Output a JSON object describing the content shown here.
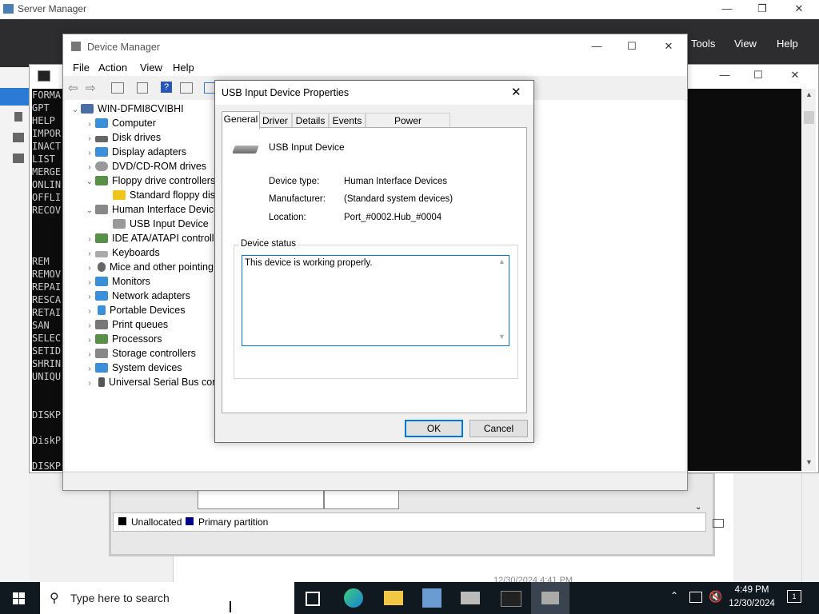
{
  "server_manager": {
    "title": "Server Manager",
    "menu": [
      "Tools",
      "View",
      "Help"
    ],
    "legend": {
      "unallocated": "Unallocated",
      "primary": "Primary partition"
    },
    "colors": {
      "unallocated": "#000000",
      "primary": "#00008b"
    }
  },
  "cmd": {
    "lines_top": [
      "FORMA",
      "GPT",
      "HELP",
      "IMPOR",
      "INACT",
      "LIST",
      "MERGE",
      "ONLIN",
      "OFFLI",
      "RECOV"
    ],
    "lines_mid": [
      "REM",
      "REMOV",
      "REPAI",
      "RESCA",
      "RETAI",
      "SAN",
      "SELEC",
      "SETID",
      "SHRIN",
      "UNIQU"
    ],
    "lines_bottom": [
      "DISKP",
      "DiskP",
      "DISKP"
    ]
  },
  "device_manager": {
    "title": "Device Manager",
    "menu": [
      "File",
      "Action",
      "View",
      "Help"
    ],
    "tree": {
      "root": "WIN-DFMI8CVIBHI",
      "items": [
        "Computer",
        "Disk drives",
        "Display adapters",
        "DVD/CD-ROM drives",
        "Floppy drive controllers",
        "Standard floppy disk",
        "Human Interface Device",
        "USB Input Device",
        "IDE ATA/ATAPI controlle",
        "Keyboards",
        "Mice and other pointing",
        "Monitors",
        "Network adapters",
        "Portable Devices",
        "Print queues",
        "Processors",
        "Storage controllers",
        "System devices",
        "Universal Serial Bus cont"
      ]
    }
  },
  "dialog": {
    "title": "USB Input Device Properties",
    "tabs": [
      "General",
      "Driver",
      "Details",
      "Events",
      "Power Management"
    ],
    "device_name": "USB Input Device",
    "fields": {
      "type_label": "Device type:",
      "type_value": "Human Interface Devices",
      "mfr_label": "Manufacturer:",
      "mfr_value": "(Standard system devices)",
      "loc_label": "Location:",
      "loc_value": "Port_#0002.Hub_#0004"
    },
    "status_caption": "Device status",
    "status_text": "This device is working properly.",
    "ok": "OK",
    "cancel": "Cancel"
  },
  "taskbar": {
    "search_placeholder": "Type here to search",
    "time": "4:49 PM",
    "date": "12/30/2024",
    "notification_count": "1",
    "hidden_date": "12/30/2024 4:41 PM"
  }
}
